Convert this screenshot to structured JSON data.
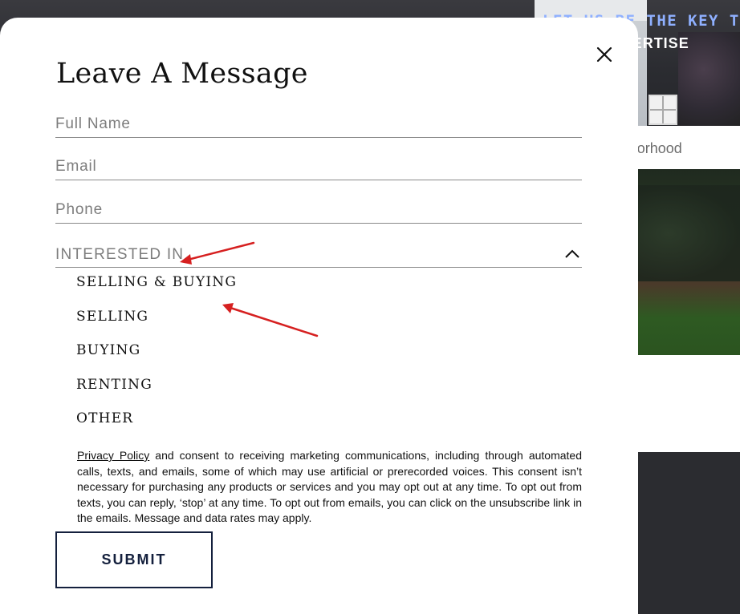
{
  "background": {
    "hero_line1": "LET US BE THE KEY TO",
    "hero_line2": "LOCAL EXPERTISE",
    "search_hint": "City, or Neighborhood"
  },
  "modal": {
    "title": "Leave A Message",
    "close_icon": "close-icon",
    "fields": {
      "full_name_placeholder": "Full Name",
      "email_placeholder": "Email",
      "phone_placeholder": "Phone"
    },
    "interested_in": {
      "label": "INTERESTED IN",
      "expanded": true,
      "chevron_icon": "chevron-up-icon",
      "options": [
        "SELLING & BUYING",
        "SELLING",
        "BUYING",
        "RENTING",
        "OTHER"
      ]
    },
    "consent": {
      "privacy_link": "Privacy Policy",
      "text": "and consent to receiving marketing communications, including through automated calls, texts, and emails, some of which may use artificial or prerecorded voices. This consent isn’t necessary for purchasing any products or services and you may opt out at any time. To opt out from texts, you can reply, ‘stop’ at any time. To opt out from emails, you can click on the unsubscribe link in the emails. Message and data rates may apply."
    },
    "submit_label": "SUBMIT"
  },
  "annotations": {
    "arrow_color": "#d62020"
  },
  "colors": {
    "accent": "#14203d",
    "hero_text_blue": "#8fb0ff"
  }
}
